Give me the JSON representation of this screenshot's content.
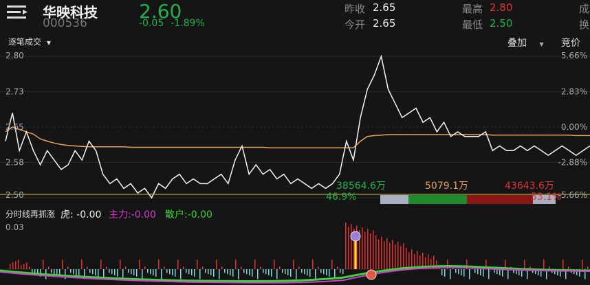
{
  "header": {
    "stock_name": "华映科技",
    "stock_code": "000536",
    "price": "2.60",
    "change": "-0.05",
    "change_pct": "-1.89%",
    "prev_close_label": "昨收",
    "prev_close": "2.65",
    "open_label": "今开",
    "open": "2.65",
    "high_label": "最高",
    "high": "2.80",
    "low_label": "最低",
    "low": "2.50",
    "volume_label_partial": "成",
    "turnover_label_partial": "换"
  },
  "toolbar": {
    "trade_tab": "逐笔成交",
    "overlay_label": "叠加",
    "auction_label": "竞价"
  },
  "chart_data": {
    "type": "line",
    "price_axis": [
      "2.80",
      "2.73",
      "2.65",
      "2.58",
      "2.50"
    ],
    "pct_axis": [
      "5.66%",
      "2.83%",
      "0.00%",
      "-2.88%",
      "-5.66%"
    ],
    "ylim": [
      2.5,
      2.8
    ],
    "prev_close": 2.65,
    "price_series": [
      2.62,
      2.68,
      2.6,
      2.64,
      2.6,
      2.57,
      2.6,
      2.58,
      2.56,
      2.57,
      2.6,
      2.58,
      2.62,
      2.6,
      2.55,
      2.53,
      2.54,
      2.52,
      2.53,
      2.51,
      2.52,
      2.5,
      2.53,
      2.52,
      2.54,
      2.55,
      2.53,
      2.54,
      2.53,
      2.53,
      2.54,
      2.55,
      2.53,
      2.58,
      2.61,
      2.55,
      2.57,
      2.55,
      2.56,
      2.54,
      2.55,
      2.53,
      2.54,
      2.53,
      2.52,
      2.53,
      2.52,
      2.53,
      2.55,
      2.62,
      2.58,
      2.67,
      2.73,
      2.76,
      2.8,
      2.73,
      2.7,
      2.67,
      2.68,
      2.69,
      2.66,
      2.67,
      2.64,
      2.66,
      2.63,
      2.64,
      2.63,
      2.63,
      2.63,
      2.64,
      2.6,
      2.61,
      2.6,
      2.6,
      2.61,
      2.6,
      2.61,
      2.6,
      2.59,
      2.6,
      2.61,
      2.6,
      2.59,
      2.6,
      2.61
    ],
    "avg_series": [
      2.64,
      2.65,
      2.645,
      2.64,
      2.635,
      2.625,
      2.62,
      2.616,
      2.613,
      2.611,
      2.61,
      2.609,
      2.608,
      2.608,
      2.608,
      2.608,
      2.608,
      2.608,
      2.607,
      2.607,
      2.607,
      2.607,
      2.607,
      2.607,
      2.607,
      2.607,
      2.607,
      2.607,
      2.607,
      2.607,
      2.607,
      2.607,
      2.607,
      2.607,
      2.607,
      2.607,
      2.607,
      2.607,
      2.606,
      2.606,
      2.606,
      2.606,
      2.606,
      2.606,
      2.606,
      2.606,
      2.606,
      2.606,
      2.606,
      2.606,
      2.606,
      2.62,
      2.63,
      2.632,
      2.633,
      2.634,
      2.634,
      2.634,
      2.634,
      2.634,
      2.634,
      2.634,
      2.634,
      2.634,
      2.634,
      2.634,
      2.634,
      2.634,
      2.634,
      2.634,
      2.633,
      2.633,
      2.633,
      2.633,
      2.633,
      2.633,
      2.633,
      2.633,
      2.633,
      2.633,
      2.633,
      2.633,
      2.632,
      2.632,
      2.632
    ],
    "flow": {
      "green_amount": "38564.6万",
      "green_pct": "46.9%",
      "mid_amount": "5079.1万",
      "red_amount": "43643.6万",
      "red_pct": "53.1%"
    }
  },
  "indicator": {
    "title": "分时线再抓涨",
    "tiger_label": "虎:",
    "tiger_value": "-0.00",
    "main_label": "主力:",
    "main_value": "-0.00",
    "retail_label": "散户:",
    "retail_value": "-0.00",
    "axis_top": "0.03"
  },
  "colors": {
    "up": "#e03232",
    "down": "#23b14d",
    "avg_line": "#e8a25a",
    "main_line": "#d33cd3",
    "retail_line": "#39d639"
  }
}
